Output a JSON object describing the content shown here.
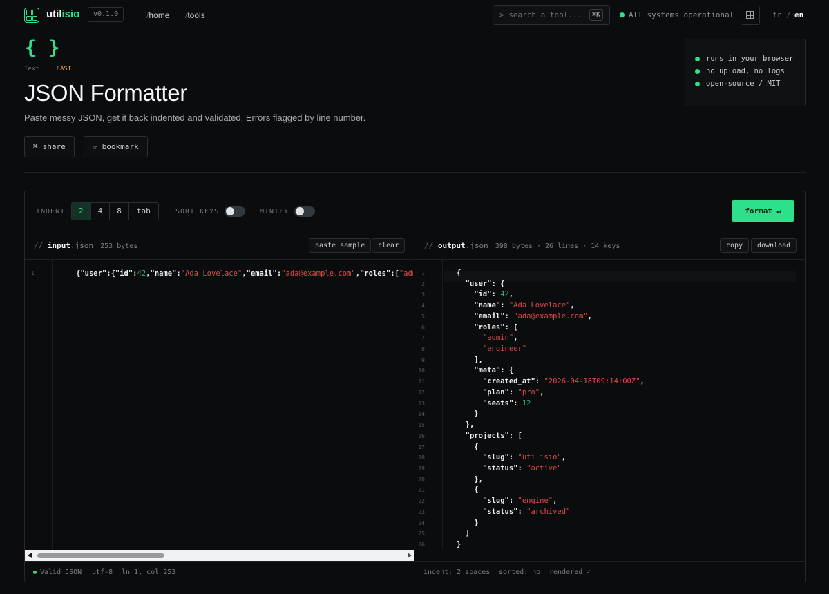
{
  "nav": {
    "brand_a": "util",
    "brand_b": "isio",
    "version": "v0.1.0",
    "links": [
      {
        "slash": "/",
        "label": "home"
      },
      {
        "slash": "/",
        "label": "tools"
      }
    ],
    "search_placeholder": "> search a tool...",
    "search_kbd": "⌘K",
    "status": "All systems operational",
    "lang_fr": "fr",
    "lang_sep": "/",
    "lang_en": "en"
  },
  "hero": {
    "icon_glyph": "{}",
    "category": "Text",
    "badge": "FAST",
    "title": "JSON Formatter",
    "subtitle": "Paste messy JSON, get it back indented and validated. Errors flagged by line number.",
    "share_label": "share",
    "share_glyph": "⌘",
    "bookmark_label": "bookmark",
    "bookmark_glyph": "☆"
  },
  "features": [
    "runs in your browser",
    "no upload, no logs",
    "open-source / MIT"
  ],
  "toolbar": {
    "indent_label": "INDENT",
    "indent_options": [
      "2",
      "4",
      "8",
      "tab"
    ],
    "indent_selected": "2",
    "sort_label": "SORT KEYS",
    "sort_keys": false,
    "minify_label": "MINIFY",
    "minify": false,
    "format_label": "format",
    "format_glyph": "↵"
  },
  "input": {
    "comment": "//",
    "name": "input",
    "ext": ".json",
    "meta": "253 bytes",
    "paste_label": "paste sample",
    "clear_label": "clear",
    "line_number": "1",
    "line": [
      {
        "t": "{\"user\":{\"id\":",
        "c": "p"
      },
      {
        "t": "42",
        "c": "n"
      },
      {
        "t": ",\"name\":",
        "c": "p"
      },
      {
        "t": "\"Ada Lovelace\"",
        "c": "s"
      },
      {
        "t": ",\"email\":",
        "c": "p"
      },
      {
        "t": "\"ada@example.com\"",
        "c": "s"
      },
      {
        "t": ",\"roles\":[",
        "c": "p"
      },
      {
        "t": "\"admin\"",
        "c": "s"
      },
      {
        "t": ",",
        "c": "p"
      }
    ],
    "foot_status": "Valid JSON",
    "foot_encoding": "utf-8",
    "foot_position": "ln 1, col 253"
  },
  "output": {
    "comment": "//",
    "name": "output",
    "ext": ".json",
    "meta": "398 bytes · 26 lines · 14 keys",
    "copy_label": "copy",
    "download_label": "download",
    "lines": [
      [
        {
          "t": "{",
          "c": "p"
        }
      ],
      [
        {
          "t": "  \"user\": {",
          "c": "k"
        }
      ],
      [
        {
          "t": "    \"id\": ",
          "c": "k"
        },
        {
          "t": "42",
          "c": "n"
        },
        {
          "t": ",",
          "c": "p"
        }
      ],
      [
        {
          "t": "    \"name\": ",
          "c": "k"
        },
        {
          "t": "\"Ada Lovelace\"",
          "c": "s"
        },
        {
          "t": ",",
          "c": "p"
        }
      ],
      [
        {
          "t": "    \"email\": ",
          "c": "k"
        },
        {
          "t": "\"ada@example.com\"",
          "c": "s"
        },
        {
          "t": ",",
          "c": "p"
        }
      ],
      [
        {
          "t": "    \"roles\": [",
          "c": "k"
        }
      ],
      [
        {
          "t": "      ",
          "c": "p"
        },
        {
          "t": "\"admin\"",
          "c": "s"
        },
        {
          "t": ",",
          "c": "p"
        }
      ],
      [
        {
          "t": "      ",
          "c": "p"
        },
        {
          "t": "\"engineer\"",
          "c": "s"
        }
      ],
      [
        {
          "t": "    ],",
          "c": "p"
        }
      ],
      [
        {
          "t": "    \"meta\": {",
          "c": "k"
        }
      ],
      [
        {
          "t": "      \"created_at\": ",
          "c": "k"
        },
        {
          "t": "\"2026-04-18T09:14:00Z\"",
          "c": "s"
        },
        {
          "t": ",",
          "c": "p"
        }
      ],
      [
        {
          "t": "      \"plan\": ",
          "c": "k"
        },
        {
          "t": "\"pro\"",
          "c": "s"
        },
        {
          "t": ",",
          "c": "p"
        }
      ],
      [
        {
          "t": "      \"seats\": ",
          "c": "k"
        },
        {
          "t": "12",
          "c": "n"
        }
      ],
      [
        {
          "t": "    }",
          "c": "p"
        }
      ],
      [
        {
          "t": "  },",
          "c": "p"
        }
      ],
      [
        {
          "t": "  \"projects\": [",
          "c": "k"
        }
      ],
      [
        {
          "t": "    {",
          "c": "p"
        }
      ],
      [
        {
          "t": "      \"slug\": ",
          "c": "k"
        },
        {
          "t": "\"utilisio\"",
          "c": "s"
        },
        {
          "t": ",",
          "c": "p"
        }
      ],
      [
        {
          "t": "      \"status\": ",
          "c": "k"
        },
        {
          "t": "\"active\"",
          "c": "s"
        }
      ],
      [
        {
          "t": "    },",
          "c": "p"
        }
      ],
      [
        {
          "t": "    {",
          "c": "p"
        }
      ],
      [
        {
          "t": "      \"slug\": ",
          "c": "k"
        },
        {
          "t": "\"engine\"",
          "c": "s"
        },
        {
          "t": ",",
          "c": "p"
        }
      ],
      [
        {
          "t": "      \"status\": ",
          "c": "k"
        },
        {
          "t": "\"archived\"",
          "c": "s"
        }
      ],
      [
        {
          "t": "    }",
          "c": "p"
        }
      ],
      [
        {
          "t": "  ]",
          "c": "p"
        }
      ],
      [
        {
          "t": "}",
          "c": "p"
        }
      ]
    ],
    "foot_indent": "indent: 2 spaces",
    "foot_sorted": "sorted: no",
    "foot_rendered": "rendered ✓"
  },
  "colors": {
    "accent": "#2fe08a",
    "string": "#e04848",
    "number": "#2fb37a",
    "badge": "#f2a23c"
  }
}
